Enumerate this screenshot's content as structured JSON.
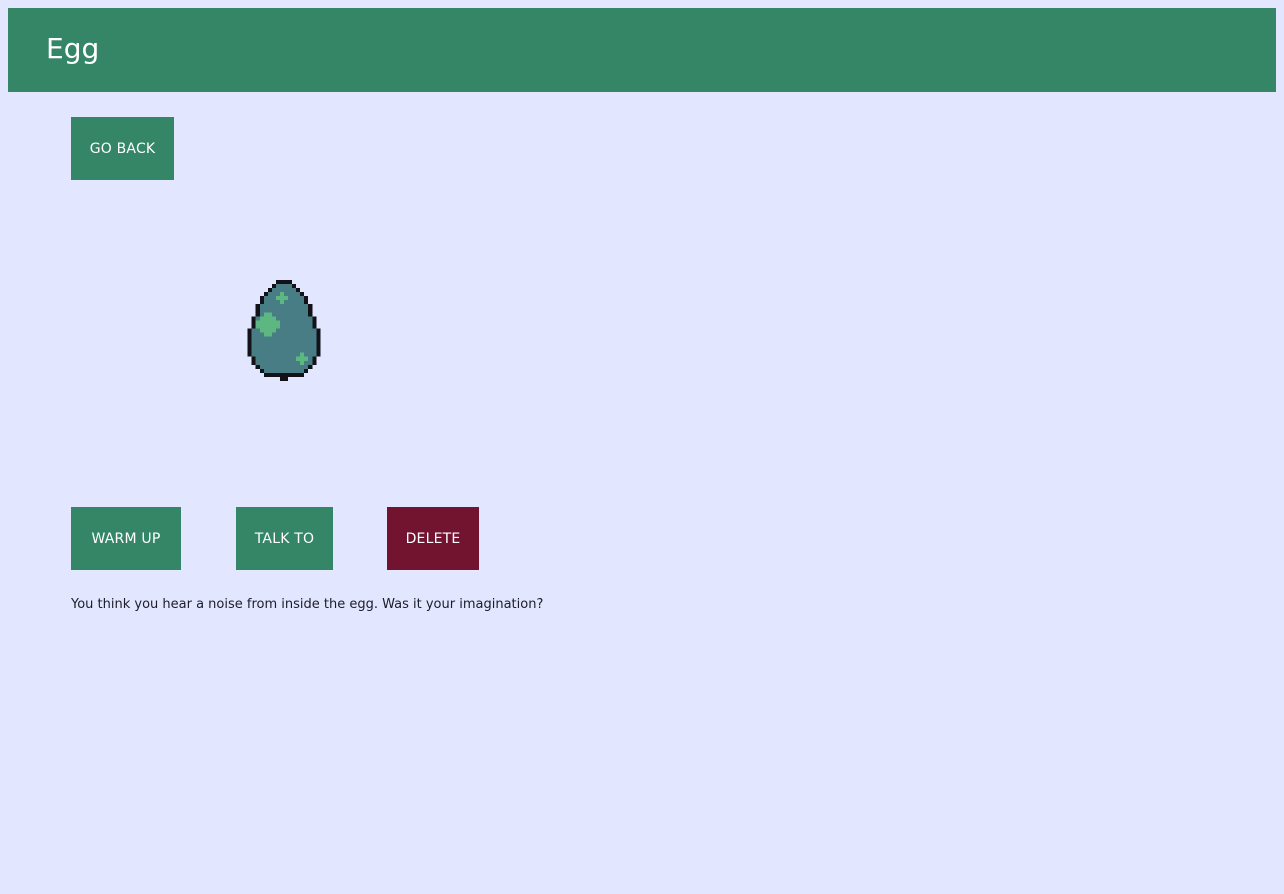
{
  "header": {
    "title": "Egg"
  },
  "navigation": {
    "back_label": "GO BACK"
  },
  "pet": {
    "image_icon": "pixel-egg-icon",
    "colors": {
      "shell": "#497d86",
      "outline": "#121218",
      "spots": "#5db781"
    }
  },
  "actions": {
    "warm_label": "WARM UP",
    "talk_label": "TALK TO",
    "delete_label": "DELETE"
  },
  "status": {
    "message": "You think you hear a noise from inside the egg. Was it your imagination?"
  },
  "theme": {
    "background": "#e2e6ff",
    "primary": "#348667",
    "danger": "#721430"
  }
}
